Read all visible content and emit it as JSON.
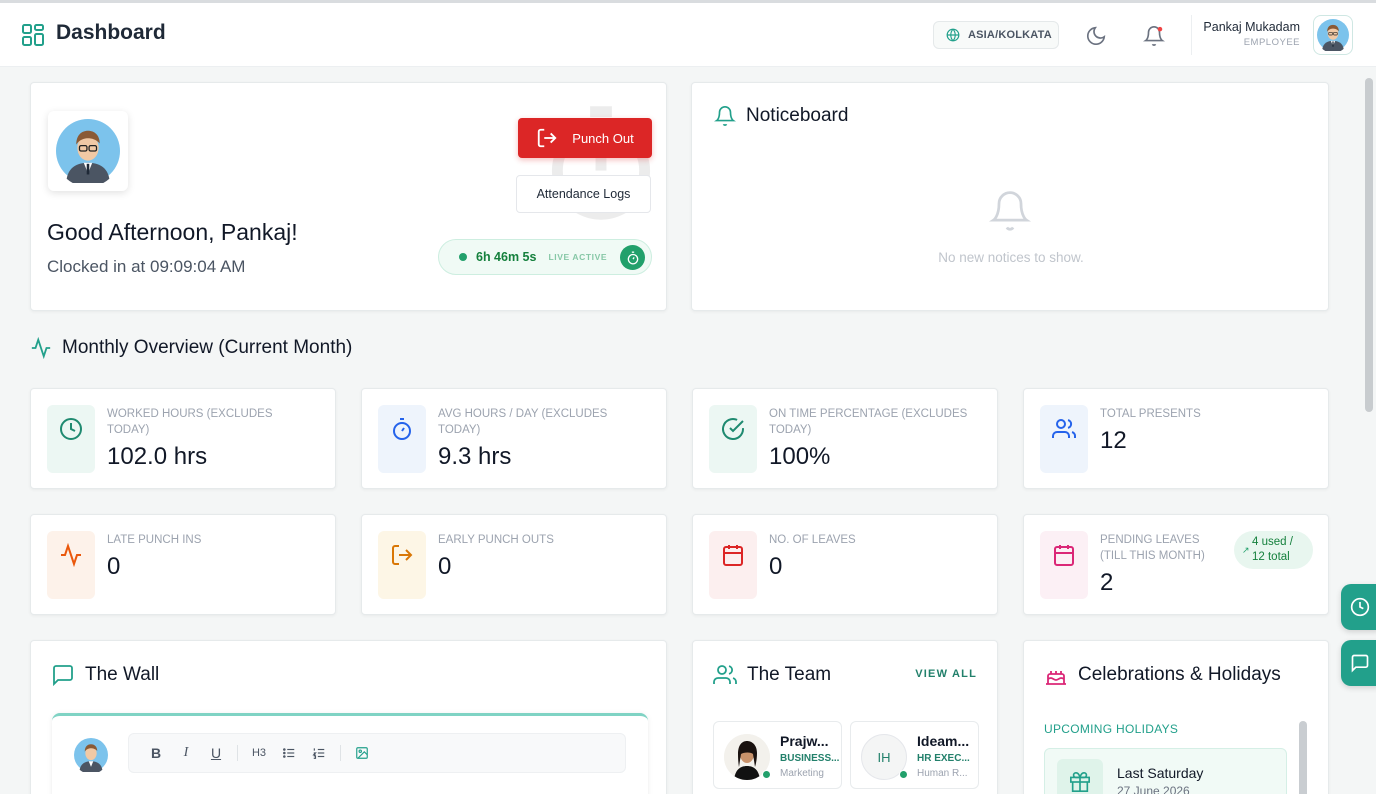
{
  "header": {
    "title": "Dashboard",
    "timezone": "ASIA/KOLKATA",
    "user_name": "Pankaj Mukadam",
    "user_role": "EMPLOYEE"
  },
  "welcome": {
    "greeting": "Good Afternoon, Pankaj!",
    "clocked_in": "Clocked in at 09:09:04 AM",
    "punch_out_label": "Punch Out",
    "attendance_logs_label": "Attendance Logs",
    "timer": "6h 46m 5s",
    "live_label": "LIVE ACTIVE"
  },
  "noticeboard": {
    "title": "Noticeboard",
    "empty_text": "No new notices to show."
  },
  "overview": {
    "title": "Monthly Overview (Current Month)",
    "stats": [
      {
        "label": "WORKED HOURS (EXCLUDES TODAY)",
        "value": "102.0 hrs",
        "icon": "clock-icon",
        "color": "#1f8a70"
      },
      {
        "label": "AVG HOURS / DAY (EXCLUDES TODAY)",
        "value": "9.3 hrs",
        "icon": "stopwatch-icon",
        "color": "#2563eb"
      },
      {
        "label": "ON TIME PERCENTAGE (EXCLUDES TODAY)",
        "value": "100%",
        "icon": "check-circle-icon",
        "color": "#1f8a70"
      },
      {
        "label": "TOTAL PRESENTS",
        "value": "12",
        "icon": "users-icon",
        "color": "#2563eb"
      },
      {
        "label": "LATE PUNCH INS",
        "value": "0",
        "icon": "activity-icon",
        "color": "#ea580c"
      },
      {
        "label": "EARLY PUNCH OUTS",
        "value": "0",
        "icon": "logout-icon",
        "color": "#d97706"
      },
      {
        "label": "NO. OF LEAVES",
        "value": "0",
        "icon": "calendar-icon",
        "color": "#dc2626"
      },
      {
        "label": "PENDING LEAVES (TILL THIS MONTH)",
        "value": "2",
        "icon": "calendar-icon",
        "color": "#db2777"
      }
    ],
    "leave_badge_line1": "4 used /",
    "leave_badge_line2": "12 total"
  },
  "wall": {
    "title": "The Wall",
    "toolbar": [
      "B",
      "I",
      "U",
      "H3",
      "bullet-list",
      "numbered-list",
      "image"
    ]
  },
  "team": {
    "title": "The Team",
    "view_all": "VIEW ALL",
    "members": [
      {
        "name": "Prajw...",
        "role": "BUSINESS...",
        "dept": "Marketing",
        "initials": ""
      },
      {
        "name": "Ideam...",
        "role": "HR EXEC...",
        "dept": "Human R...",
        "initials": "IH"
      }
    ]
  },
  "celebrations": {
    "title": "Celebrations & Holidays",
    "upcoming_label": "UPCOMING HOLIDAYS",
    "holiday_name": "Last Saturday",
    "holiday_date": "27 June 2026"
  },
  "colors": {
    "accent": "#22a08b",
    "danger": "#dc2626",
    "success": "#22a06b"
  }
}
